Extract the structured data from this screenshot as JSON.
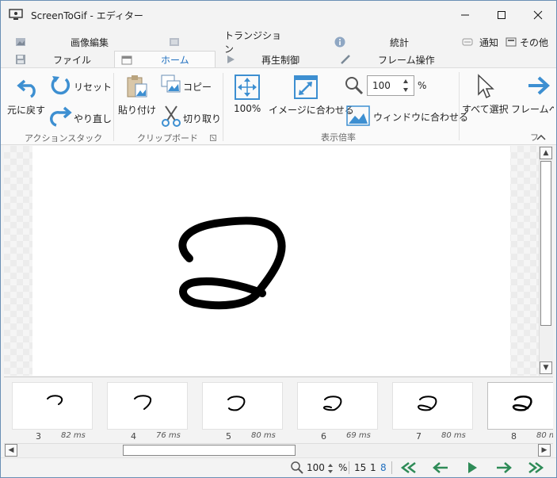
{
  "window": {
    "title": "ScreenToGif - エディター"
  },
  "tabs_row1": [
    {
      "label": "画像編集",
      "icon": "image-icon"
    },
    {
      "label": "トランジション",
      "icon": "transition-icon"
    },
    {
      "label": "統計",
      "icon": "info-icon"
    },
    {
      "label": "通知",
      "icon": "notification-icon"
    },
    {
      "label": "その他",
      "icon": "other-icon"
    }
  ],
  "tabs_row2": [
    {
      "label": "ファイル",
      "icon": "save-icon"
    },
    {
      "label": "ホーム",
      "icon": "home-icon",
      "active": true
    },
    {
      "label": "再生制御",
      "icon": "play-icon"
    },
    {
      "label": "フレーム操作",
      "icon": "pencil-icon"
    }
  ],
  "ribbon": {
    "undo": "元に戻す",
    "reset": "リセット",
    "redo": "やり直し",
    "paste": "貼り付け",
    "copy": "コピー",
    "cut": "切り取り",
    "zoom100": "100%",
    "fit_image": "イメージに合わせる",
    "zoom_value": "100",
    "zoom_unit": "%",
    "fit_window": "ウィンドウに合わせる",
    "select_all": "すべて選択",
    "frame_next": "フレームへ",
    "groups": {
      "action_stack": "アクションスタック",
      "clipboard": "クリップボード",
      "zoom": "表示倍率",
      "select": "フ"
    }
  },
  "frames": [
    {
      "number": "3",
      "ms": "82 ms"
    },
    {
      "number": "4",
      "ms": "76 ms"
    },
    {
      "number": "5",
      "ms": "80 ms"
    },
    {
      "number": "6",
      "ms": "69 ms"
    },
    {
      "number": "7",
      "ms": "80 ms"
    },
    {
      "number": "8",
      "ms": "80 m"
    }
  ],
  "status": {
    "zoom": "100",
    "zoom_unit": "%",
    "total_frames": "15",
    "selected_count": "1",
    "current_frame": "8"
  },
  "colors": {
    "accent": "#1f6fbf",
    "nav_green": "#2e8b57"
  }
}
